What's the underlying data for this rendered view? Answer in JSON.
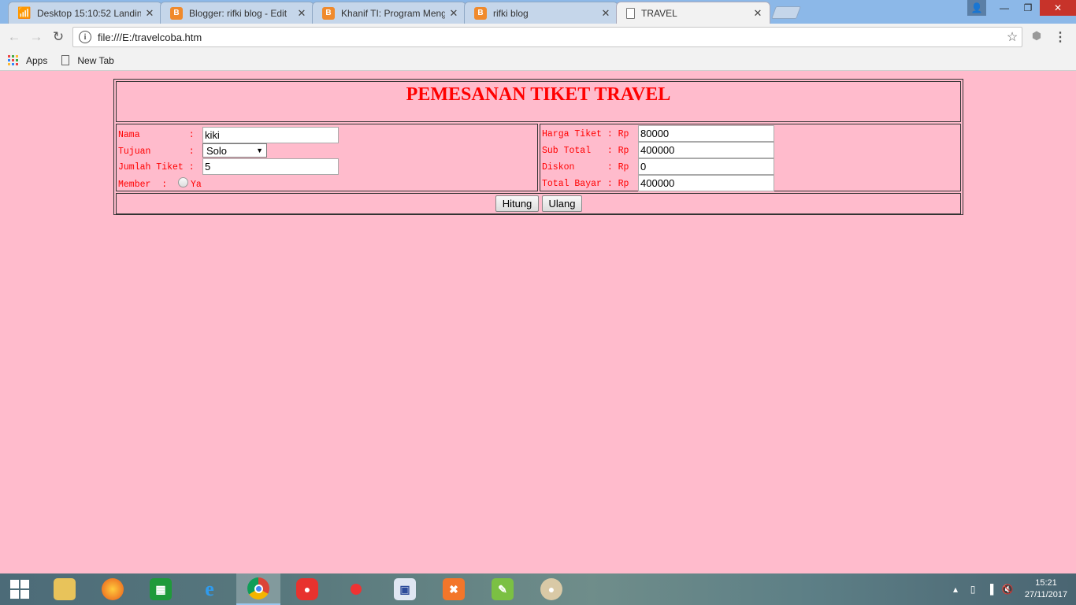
{
  "browser": {
    "tabs": [
      {
        "title": "Desktop 15:10:52 Landin",
        "icon": "wifi-icon",
        "active": false
      },
      {
        "title": "Blogger: rifki blog - Edit",
        "icon": "blogger-icon",
        "active": false
      },
      {
        "title": "Khanif TI: Program Meng",
        "icon": "blogger-icon",
        "active": false
      },
      {
        "title": "rifki blog",
        "icon": "blogger-icon",
        "active": false
      },
      {
        "title": "TRAVEL",
        "icon": "page-icon",
        "active": true
      }
    ],
    "address": "file:///E:/travelcoba.htm",
    "bookmarks": [
      {
        "label": "Apps",
        "icon": "apps-grid-icon"
      },
      {
        "label": "New Tab",
        "icon": "page-icon"
      }
    ]
  },
  "form": {
    "title": "PEMESANAN TIKET TRAVEL",
    "nama_label": "Nama         :",
    "nama_value": "kiki",
    "tujuan_label": "Tujuan       :",
    "tujuan_value": "Solo",
    "jumlah_label": "Jumlah Tiket :",
    "jumlah_value": "5",
    "member_label": "Member  :",
    "member_option": "Ya",
    "harga_label": "Harga Tiket : Rp",
    "harga_value": "80000",
    "subtotal_label": "Sub Total   : Rp",
    "subtotal_value": "400000",
    "diskon_label": "Diskon      : Rp",
    "diskon_value": "0",
    "total_label": "Total Bayar : Rp",
    "total_value": "400000",
    "hitung_label": "Hitung",
    "ulang_label": "Ulang"
  },
  "colors": {
    "page_background": "#ffbbcc",
    "text_red": "#ff0000",
    "blogger_orange": "#f08a2c"
  },
  "taskbar": {
    "apps": [
      "start-icon",
      "file-explorer-icon",
      "firefox-icon",
      "store-icon",
      "internet-explorer-icon",
      "chrome-icon",
      "app-red-icon",
      "maps-icon",
      "media-icon",
      "xampp-icon",
      "notepad-icon",
      "paint-icon"
    ],
    "time": "15:21",
    "date": "27/11/2017"
  }
}
